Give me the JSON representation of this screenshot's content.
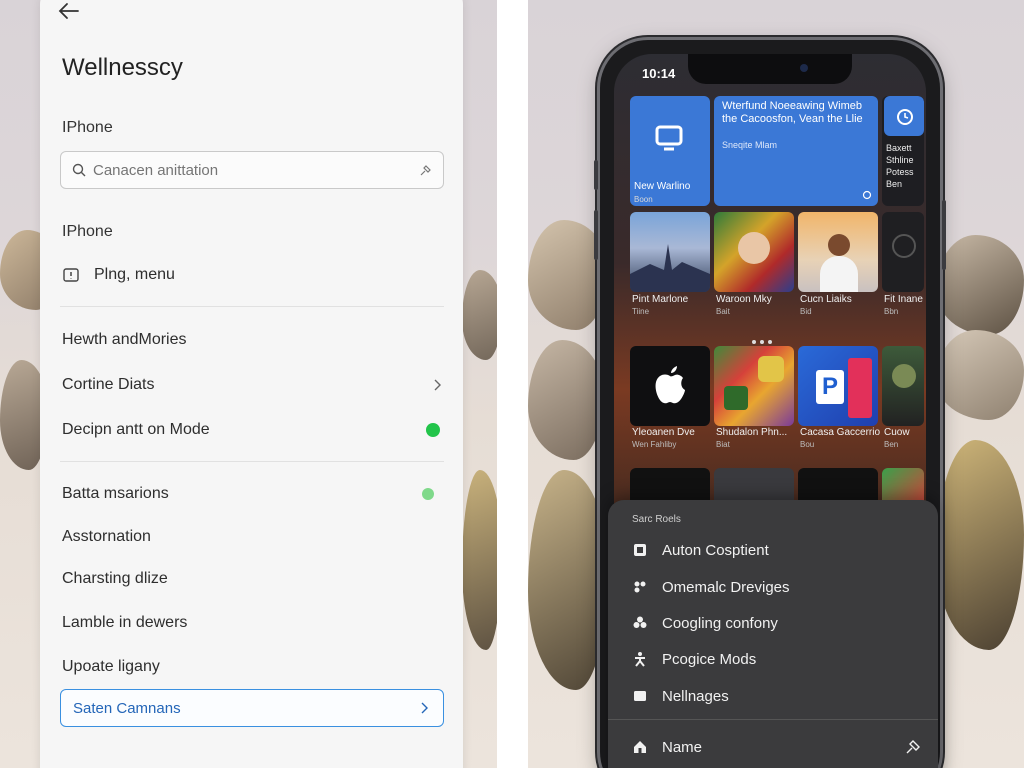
{
  "settings": {
    "title": "Wellnesscy",
    "section1_label": "IPhone",
    "search_placeholder": "Canacen anittation",
    "section2_label": "IPhone",
    "ping_menu_label": "Plng, menu",
    "rows": [
      {
        "label": "Hewth andMories"
      },
      {
        "label": "Cortine Diats"
      },
      {
        "label": "Decipn antt on Mode",
        "status_color": "#22c44a"
      },
      {
        "label": "Batta msarions",
        "status_color": "#7fd98a"
      },
      {
        "label": "Asstornation"
      },
      {
        "label": "Charsting dlize"
      },
      {
        "label": "Lamble in dewers"
      },
      {
        "label": "Upoate ligany"
      }
    ],
    "selected_row_label": "Saten Camnans",
    "accent_color": "#3a90e0"
  },
  "phone": {
    "time": "10:14",
    "news_widget": {
      "headline": "Wterfund Noeeawing Wimeb the Cacoosfon, Vean the Llie",
      "sub": "Sneqite Mlam"
    },
    "top_left_tile": {
      "title": "New Warlino",
      "sub": "Boon"
    },
    "right_widget": {
      "lines": [
        "Baxett",
        "Sthline",
        "Potess",
        "Ben"
      ]
    },
    "row2": [
      {
        "title": "Pint Marlone",
        "sub": "Tiine"
      },
      {
        "title": "Waroon Mky",
        "sub": "Bait"
      },
      {
        "title": "Cucn Liaiks",
        "sub": "Bid"
      },
      {
        "title": "Fit Inane",
        "sub": "Bbn"
      }
    ],
    "row3": [
      {
        "title": "Yleoanen Dve",
        "sub": "Wen Fahliby"
      },
      {
        "title": "Shudalon Phn...",
        "sub": "Biat"
      },
      {
        "title": "Cacasa Gaccerrio",
        "sub": "Bou"
      },
      {
        "title": "Cuow",
        "sub": "Ben"
      }
    ]
  },
  "menu": {
    "title": "Sarc Roels",
    "items": [
      {
        "label": "Auton Cosptient",
        "icon": "square-icon"
      },
      {
        "label": "Omemalc Dreviges",
        "icon": "cluster-icon"
      },
      {
        "label": "Coogling confony",
        "icon": "club-icon"
      },
      {
        "label": "Pcogice Mods",
        "icon": "figure-icon"
      },
      {
        "label": "Nellnages",
        "icon": "box-icon"
      }
    ],
    "footer_label": "Name"
  }
}
